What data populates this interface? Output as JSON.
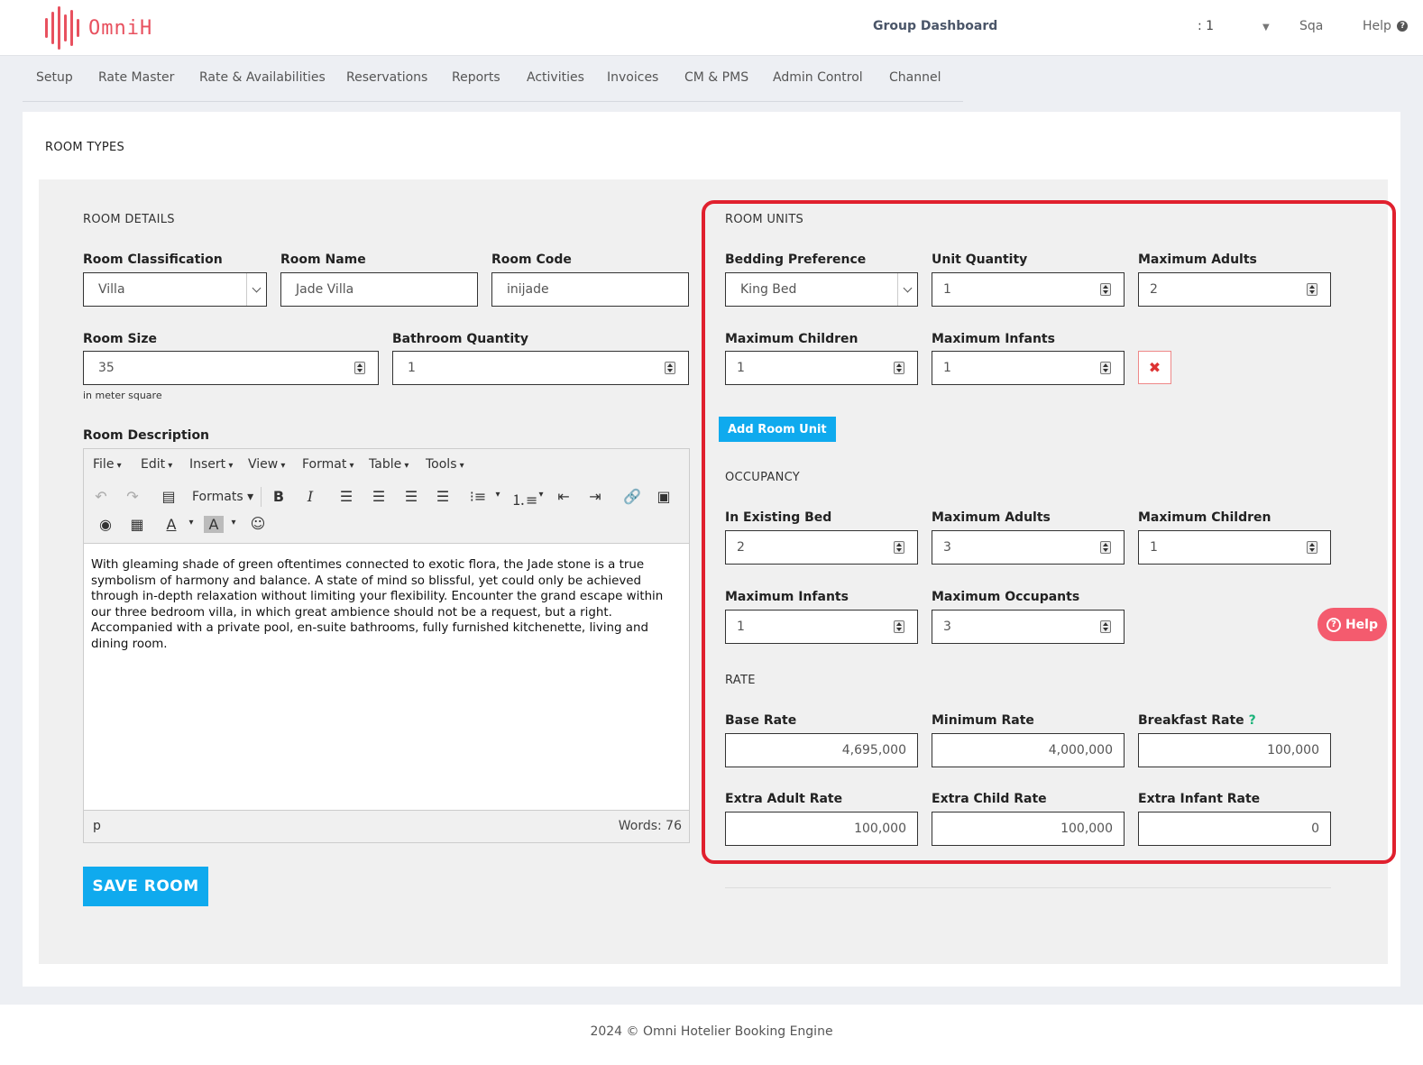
{
  "brand": {
    "name": "OmniH",
    "color": "#e8515f"
  },
  "topbar": {
    "group_dashboard": "Group Dashboard",
    "counter": ": 1",
    "user": "Sqa",
    "help": "Help"
  },
  "nav": [
    "Setup",
    "Rate Master",
    "Rate & Availabilities",
    "Reservations",
    "Reports",
    "Activities",
    "Invoices",
    "CM & PMS",
    "Admin Control",
    "Channel"
  ],
  "page_title": "ROOM TYPES",
  "room_details": {
    "title": "ROOM DETAILS",
    "classification": {
      "label": "Room Classification",
      "value": "Villa"
    },
    "name": {
      "label": "Room Name",
      "value": "Jade Villa"
    },
    "code": {
      "label": "Room Code",
      "value": "inijade"
    },
    "size": {
      "label": "Room Size",
      "value": "35",
      "hint": "in meter square"
    },
    "bathroom": {
      "label": "Bathroom Quantity",
      "value": "1"
    },
    "description": {
      "label": "Room Description",
      "menus": [
        "File",
        "Edit",
        "Insert",
        "View",
        "Format",
        "Table",
        "Tools"
      ],
      "formats": "Formats",
      "text": "With gleaming shade of green oftentimes connected to exotic flora, the Jade stone is a true symbolism of harmony and balance. A state of mind so blissful, yet could only be achieved through in-depth relaxation without limiting your flexibility. Encounter the grand escape within our three bedroom villa, in which great ambience should not be a request, but a right. Accompanied with a private pool, en-suite bathrooms, fully furnished kitchenette, living and dining room.",
      "status_tag": "p",
      "word_count": "Words: 76"
    },
    "save": "SAVE ROOM"
  },
  "room_units": {
    "title": "ROOM UNITS",
    "bedding": {
      "label": "Bedding Preference",
      "value": "King Bed"
    },
    "unit_qty": {
      "label": "Unit Quantity",
      "value": "1"
    },
    "max_adults": {
      "label": "Maximum Adults",
      "value": "2"
    },
    "max_children": {
      "label": "Maximum Children",
      "value": "1"
    },
    "max_infants": {
      "label": "Maximum Infants",
      "value": "1"
    },
    "add": "Add Room Unit"
  },
  "occupancy": {
    "title": "OCCUPANCY",
    "existing_bed": {
      "label": "In Existing Bed",
      "value": "2"
    },
    "max_adults": {
      "label": "Maximum Adults",
      "value": "3"
    },
    "max_children": {
      "label": "Maximum Children",
      "value": "1"
    },
    "max_infants": {
      "label": "Maximum Infants",
      "value": "1"
    },
    "max_occupants": {
      "label": "Maximum Occupants",
      "value": "3"
    }
  },
  "rate": {
    "title": "RATE",
    "base": {
      "label": "Base Rate",
      "value": "4,695,000"
    },
    "minimum": {
      "label": "Minimum Rate",
      "value": "4,000,000"
    },
    "breakfast": {
      "label": "Breakfast Rate",
      "value": "100,000",
      "hint": "?"
    },
    "extra_adult": {
      "label": "Extra Adult Rate",
      "value": "100,000"
    },
    "extra_child": {
      "label": "Extra Child Rate",
      "value": "100,000"
    },
    "extra_infant": {
      "label": "Extra Infant Rate",
      "value": "0"
    }
  },
  "help_button": "Help",
  "footer": "2024 © Omni Hotelier Booking Engine",
  "colors": {
    "accent": "#0faaee",
    "highlight": "#e0202e",
    "help": "#f45b6e"
  }
}
